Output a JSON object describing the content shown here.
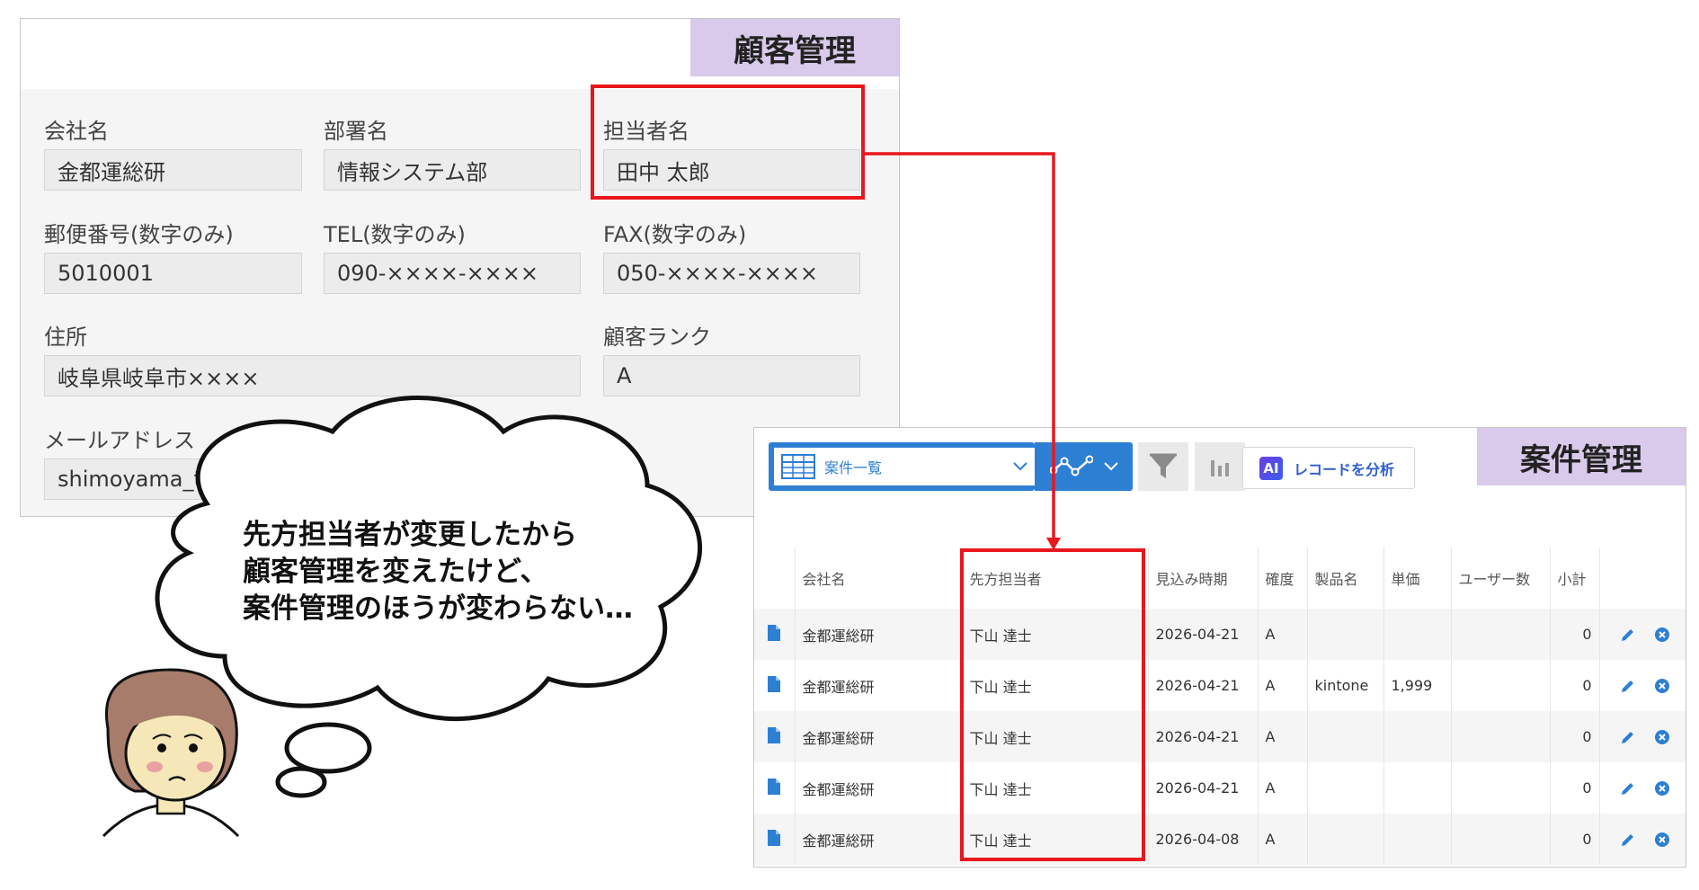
{
  "customer_form": {
    "title": "顧客管理",
    "fields": {
      "company": {
        "label": "会社名",
        "value": "金都運総研"
      },
      "department": {
        "label": "部署名",
        "value": "情報システム部"
      },
      "contact": {
        "label": "担当者名",
        "value": "田中 太郎"
      },
      "postal": {
        "label": "郵便番号(数字のみ)",
        "value": "5010001"
      },
      "tel": {
        "label": "TEL(数字のみ)",
        "value": "090-××××-××××"
      },
      "fax": {
        "label": "FAX(数字のみ)",
        "value": "050-××××-××××"
      },
      "address": {
        "label": "住所",
        "value": "岐阜県岐阜市××××"
      },
      "rank": {
        "label": "顧客ランク",
        "value": "A"
      },
      "email": {
        "label": "メールアドレス",
        "value": "shimoyama_tatsuh"
      }
    }
  },
  "deal_list": {
    "title": "案件管理",
    "view_selector": {
      "label": "案件一覧"
    },
    "ai_button": {
      "badge": "AI",
      "label": "レコードを分析"
    },
    "columns": [
      "会社名",
      "先方担当者",
      "見込み時期",
      "確度",
      "製品名",
      "単価",
      "ユーザー数",
      "小計"
    ],
    "rows": [
      {
        "company": "金都運総研",
        "contact": "下山 達士",
        "date": "2026-04-21",
        "certainty": "A",
        "product": "",
        "price": "",
        "users": "",
        "subtotal": "0"
      },
      {
        "company": "金都運総研",
        "contact": "下山 達士",
        "date": "2026-04-21",
        "certainty": "A",
        "product": "kintone",
        "price": "1,999",
        "users": "",
        "subtotal": "0"
      },
      {
        "company": "金都運総研",
        "contact": "下山 達士",
        "date": "2026-04-21",
        "certainty": "A",
        "product": "",
        "price": "",
        "users": "",
        "subtotal": "0"
      },
      {
        "company": "金都運総研",
        "contact": "下山 達士",
        "date": "2026-04-21",
        "certainty": "A",
        "product": "",
        "price": "",
        "users": "",
        "subtotal": "0"
      },
      {
        "company": "金都運総研",
        "contact": "下山 達士",
        "date": "2026-04-08",
        "certainty": "A",
        "product": "",
        "price": "",
        "users": "",
        "subtotal": "0"
      }
    ]
  },
  "thought_bubble": {
    "lines": [
      "先方担当者が変更したから",
      "顧客管理を変えたけど、",
      "案件管理のほうが変わらない…"
    ]
  },
  "colors": {
    "highlight_red": "#e8171d",
    "tag_purple": "#d9c9ea",
    "kintone_blue": "#2d7fd4"
  }
}
